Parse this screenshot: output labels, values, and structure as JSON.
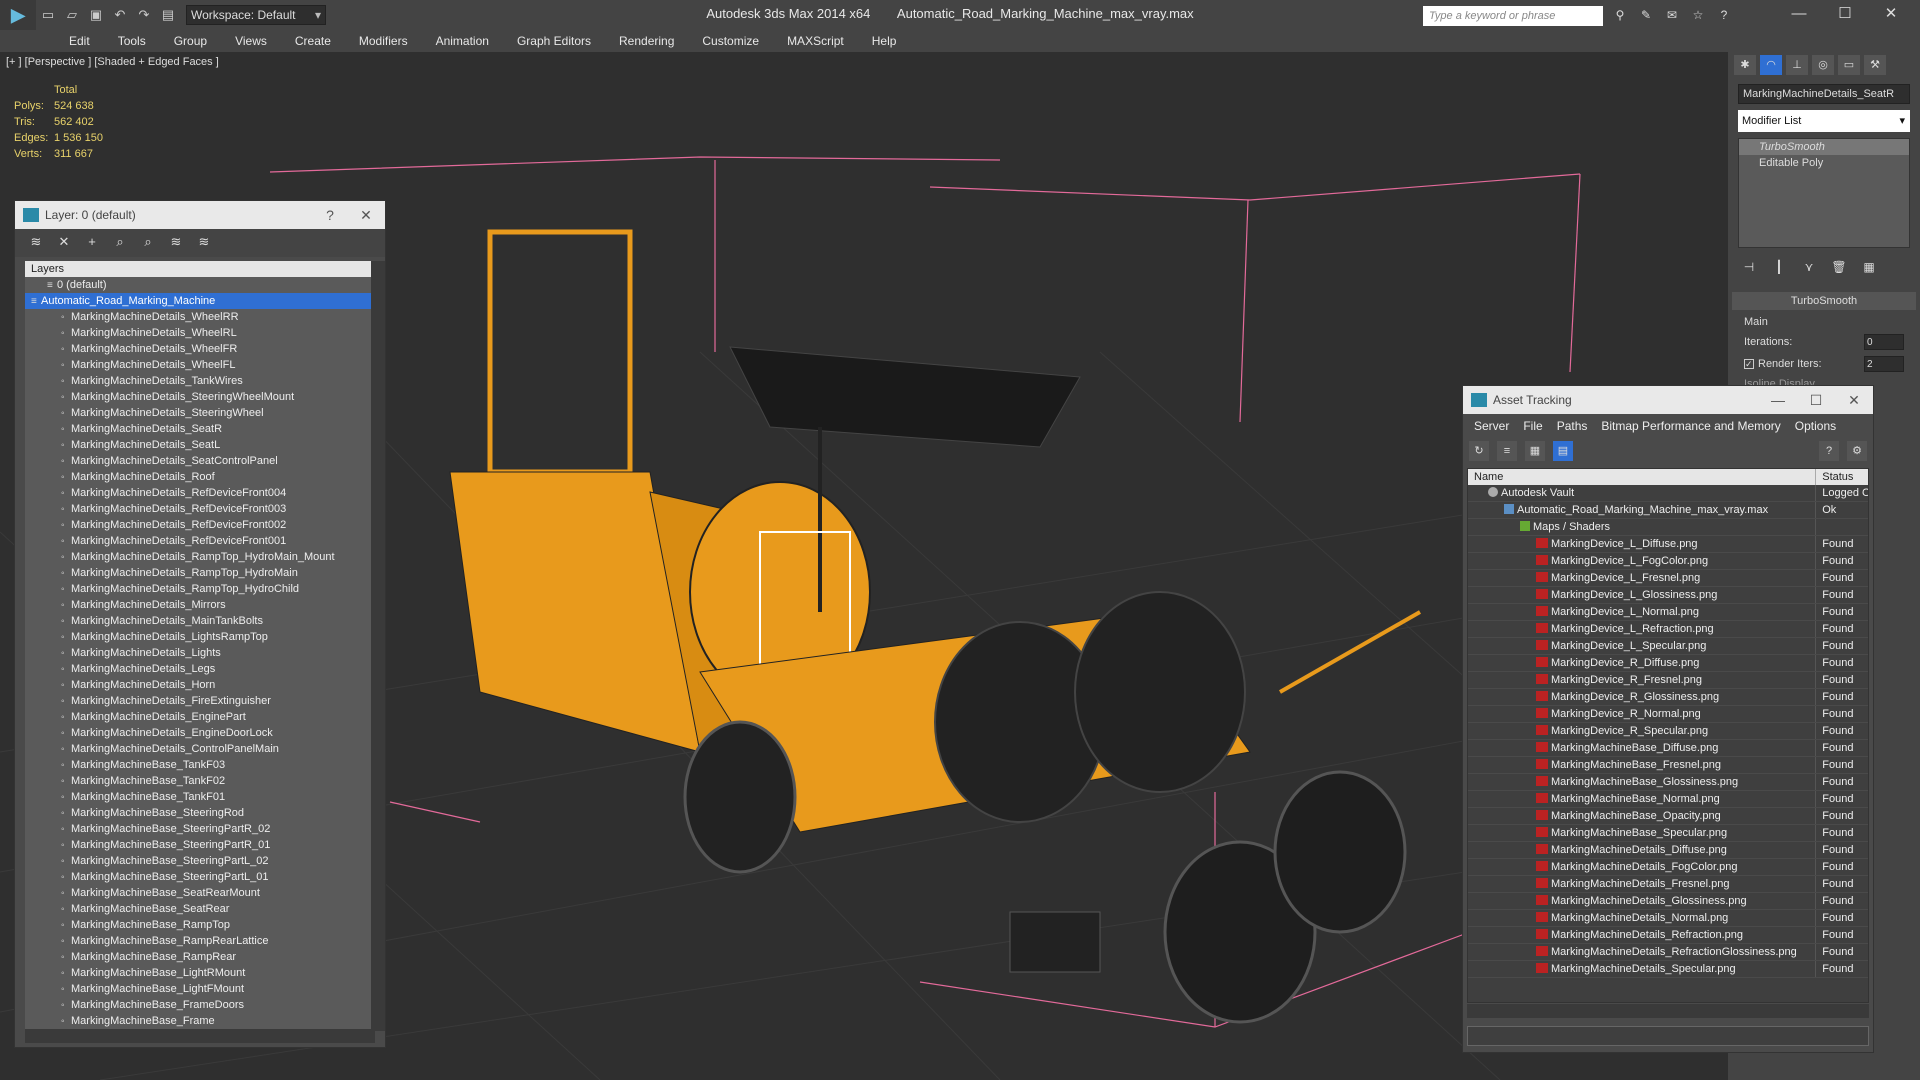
{
  "window": {
    "app": "Autodesk 3ds Max  2014 x64",
    "file": "Automatic_Road_Marking_Machine_max_vray.max",
    "workspace": "Workspace: Default",
    "search_placeholder": "Type a keyword or phrase"
  },
  "menu": [
    "Edit",
    "Tools",
    "Group",
    "Views",
    "Create",
    "Modifiers",
    "Animation",
    "Graph Editors",
    "Rendering",
    "Customize",
    "MAXScript",
    "Help"
  ],
  "viewport": {
    "label": "[+ ] [Perspective ] [Shaded + Edged Faces ]",
    "stats": {
      "header": "Total",
      "polys_label": "Polys:",
      "polys": "524 638",
      "tris_label": "Tris:",
      "tris": "562 402",
      "edges_label": "Edges:",
      "edges": "1 536 150",
      "verts_label": "Verts:",
      "verts": "311 667"
    }
  },
  "command_panel": {
    "object_name": "MarkingMachineDetails_SeatR",
    "modifier_list": "Modifier List",
    "stack": [
      "TurboSmooth",
      "Editable Poly"
    ],
    "rollout": "TurboSmooth",
    "main_label": "Main",
    "iterations_label": "Iterations:",
    "iterations": "0",
    "render_iters_label": "Render Iters:",
    "render_iters": "2",
    "isoline_label": "Isoline Display"
  },
  "layer_dialog": {
    "title": "Layer: 0 (default)",
    "header": "Layers",
    "rows": [
      "0 (default)",
      "Automatic_Road_Marking_Machine",
      "MarkingMachineDetails_WheelRR",
      "MarkingMachineDetails_WheelRL",
      "MarkingMachineDetails_WheelFR",
      "MarkingMachineDetails_WheelFL",
      "MarkingMachineDetails_TankWires",
      "MarkingMachineDetails_SteeringWheelMount",
      "MarkingMachineDetails_SteeringWheel",
      "MarkingMachineDetails_SeatR",
      "MarkingMachineDetails_SeatL",
      "MarkingMachineDetails_SeatControlPanel",
      "MarkingMachineDetails_Roof",
      "MarkingMachineDetails_RefDeviceFront004",
      "MarkingMachineDetails_RefDeviceFront003",
      "MarkingMachineDetails_RefDeviceFront002",
      "MarkingMachineDetails_RefDeviceFront001",
      "MarkingMachineDetails_RampTop_HydroMain_Mount",
      "MarkingMachineDetails_RampTop_HydroMain",
      "MarkingMachineDetails_RampTop_HydroChild",
      "MarkingMachineDetails_Mirrors",
      "MarkingMachineDetails_MainTankBolts",
      "MarkingMachineDetails_LightsRampTop",
      "MarkingMachineDetails_Lights",
      "MarkingMachineDetails_Legs",
      "MarkingMachineDetails_Horn",
      "MarkingMachineDetails_FireExtinguisher",
      "MarkingMachineDetails_EnginePart",
      "MarkingMachineDetails_EngineDoorLock",
      "MarkingMachineDetails_ControlPanelMain",
      "MarkingMachineBase_TankF03",
      "MarkingMachineBase_TankF02",
      "MarkingMachineBase_TankF01",
      "MarkingMachineBase_SteeringRod",
      "MarkingMachineBase_SteeringPartR_02",
      "MarkingMachineBase_SteeringPartR_01",
      "MarkingMachineBase_SteeringPartL_02",
      "MarkingMachineBase_SteeringPartL_01",
      "MarkingMachineBase_SeatRearMount",
      "MarkingMachineBase_SeatRear",
      "MarkingMachineBase_RampTop",
      "MarkingMachineBase_RampRearLattice",
      "MarkingMachineBase_RampRear",
      "MarkingMachineBase_LightRMount",
      "MarkingMachineBase_LightFMount",
      "MarkingMachineBase_FrameDoors",
      "MarkingMachineBase_Frame"
    ]
  },
  "asset_tracking": {
    "title": "Asset Tracking",
    "menu": [
      "Server",
      "File",
      "Paths",
      "Bitmap Performance and Memory",
      "Options"
    ],
    "col_name": "Name",
    "col_status": "Status",
    "vault": {
      "name": "Autodesk Vault",
      "status": "Logged Out"
    },
    "max_file": {
      "name": "Automatic_Road_Marking_Machine_max_vray.max",
      "status": "Ok"
    },
    "maps_folder": "Maps / Shaders",
    "files": [
      {
        "name": "MarkingDevice_L_Diffuse.png",
        "status": "Found"
      },
      {
        "name": "MarkingDevice_L_FogColor.png",
        "status": "Found"
      },
      {
        "name": "MarkingDevice_L_Fresnel.png",
        "status": "Found"
      },
      {
        "name": "MarkingDevice_L_Glossiness.png",
        "status": "Found"
      },
      {
        "name": "MarkingDevice_L_Normal.png",
        "status": "Found"
      },
      {
        "name": "MarkingDevice_L_Refraction.png",
        "status": "Found"
      },
      {
        "name": "MarkingDevice_L_Specular.png",
        "status": "Found"
      },
      {
        "name": "MarkingDevice_R_Diffuse.png",
        "status": "Found"
      },
      {
        "name": "MarkingDevice_R_Fresnel.png",
        "status": "Found"
      },
      {
        "name": "MarkingDevice_R_Glossiness.png",
        "status": "Found"
      },
      {
        "name": "MarkingDevice_R_Normal.png",
        "status": "Found"
      },
      {
        "name": "MarkingDevice_R_Specular.png",
        "status": "Found"
      },
      {
        "name": "MarkingMachineBase_Diffuse.png",
        "status": "Found"
      },
      {
        "name": "MarkingMachineBase_Fresnel.png",
        "status": "Found"
      },
      {
        "name": "MarkingMachineBase_Glossiness.png",
        "status": "Found"
      },
      {
        "name": "MarkingMachineBase_Normal.png",
        "status": "Found"
      },
      {
        "name": "MarkingMachineBase_Opacity.png",
        "status": "Found"
      },
      {
        "name": "MarkingMachineBase_Specular.png",
        "status": "Found"
      },
      {
        "name": "MarkingMachineDetails_Diffuse.png",
        "status": "Found"
      },
      {
        "name": "MarkingMachineDetails_FogColor.png",
        "status": "Found"
      },
      {
        "name": "MarkingMachineDetails_Fresnel.png",
        "status": "Found"
      },
      {
        "name": "MarkingMachineDetails_Glossiness.png",
        "status": "Found"
      },
      {
        "name": "MarkingMachineDetails_Normal.png",
        "status": "Found"
      },
      {
        "name": "MarkingMachineDetails_Refraction.png",
        "status": "Found"
      },
      {
        "name": "MarkingMachineDetails_RefractionGlossiness.png",
        "status": "Found"
      },
      {
        "name": "MarkingMachineDetails_Specular.png",
        "status": "Found"
      }
    ]
  },
  "colors": {
    "accent": "#2f6fd3",
    "model_orange": "#e89a1c",
    "stats_yellow": "#e8d26a",
    "bbox_pink": "#e36a9a"
  }
}
